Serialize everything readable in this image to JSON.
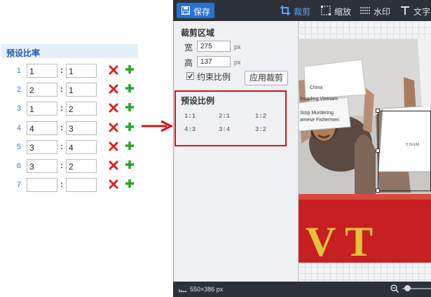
{
  "left_panel": {
    "title": "预设比率",
    "rows": [
      {
        "index": "1",
        "a": "1",
        "b": "1"
      },
      {
        "index": "2",
        "a": "2",
        "b": "1"
      },
      {
        "index": "3",
        "a": "1",
        "b": "2"
      },
      {
        "index": "4",
        "a": "4",
        "b": "3"
      },
      {
        "index": "5",
        "a": "3",
        "b": "4"
      },
      {
        "index": "6",
        "a": "3",
        "b": "2"
      },
      {
        "index": "7",
        "a": "",
        "b": ""
      }
    ],
    "separator": ":",
    "delete_icon": "red-x-icon",
    "add_icon": "green-plus-icon"
  },
  "toolbar": {
    "save_label": "保存",
    "tools": {
      "crop": "裁剪",
      "resize": "缩放",
      "watermark": "水印",
      "text": "文字"
    }
  },
  "crop_panel": {
    "title": "裁剪区域",
    "width_label": "宽",
    "width_value": "275",
    "height_label": "高",
    "height_value": "137",
    "unit": "px",
    "constrain_label": "约束比例",
    "constrain_checked": true,
    "apply_label": "应用裁剪"
  },
  "preset_panel": {
    "title": "预设比例",
    "ratios": [
      "1:1",
      "2:1",
      "1:2",
      "4:3",
      "3:4",
      "3:2"
    ]
  },
  "canvas": {
    "sign_line1": "China",
    "sign_line2": "Invading Vietnam",
    "sign_line3": "Stop Murdering",
    "sign_line4": "amese Fishermen",
    "sign_right": "T NAM",
    "banner_text": "V T"
  },
  "status_bar": {
    "image_size": "550×386 px"
  },
  "colors": {
    "toolbar_bg": "#2d323a",
    "accent": "#2573d1",
    "highlight_border": "#d0141c",
    "active_tool": "#5da4ff"
  }
}
